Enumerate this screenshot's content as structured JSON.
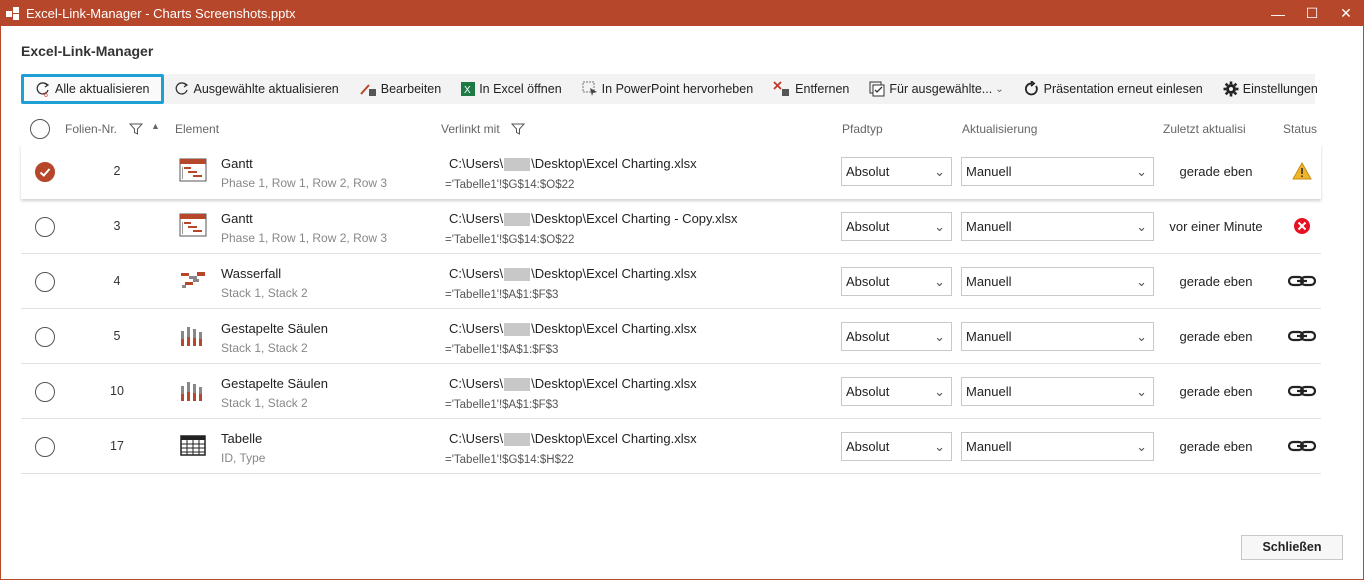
{
  "window": {
    "title": "Excel-Link-Manager - Charts Screenshots.pptx",
    "minimize": "—",
    "maximize": "☐",
    "close": "✕"
  },
  "heading": "Excel-Link-Manager",
  "toolbar": {
    "update_all": "Alle aktualisieren",
    "update_selected": "Ausgewählte aktualisieren",
    "edit": "Bearbeiten",
    "open_excel": "In Excel öffnen",
    "highlight_ppt": "In PowerPoint hervorheben",
    "remove": "Entfernen",
    "for_selected": "Für ausgewählte...",
    "reload": "Präsentation erneut einlesen",
    "settings": "Einstellungen",
    "update_badge": "6"
  },
  "columns": {
    "slide": "Folien-Nr.",
    "element": "Element",
    "linked": "Verlinkt mit",
    "pathtype": "Pfadtyp",
    "update": "Aktualisierung",
    "last": "Zuletzt aktualisi",
    "status": "Status"
  },
  "rows": [
    {
      "selected": true,
      "slide": "2",
      "icon": "gantt-icon",
      "name": "Gantt",
      "sub": "Phase 1, Row 1, Row 2, Row 3",
      "path_pre": "C:\\Users\\",
      "path_post": "\\Desktop\\Excel Charting.xlsx",
      "range": "='Tabelle1'!$G$14:$O$22",
      "pathtype": "Absolut",
      "update": "Manuell",
      "last": "gerade eben",
      "status": "warning-icon"
    },
    {
      "selected": false,
      "slide": "3",
      "icon": "gantt-icon",
      "name": "Gantt",
      "sub": "Phase 1, Row 1, Row 2, Row 3",
      "path_pre": "C:\\Users\\",
      "path_post": "\\Desktop\\Excel Charting - Copy.xlsx",
      "range": "='Tabelle1'!$G$14:$O$22",
      "pathtype": "Absolut",
      "update": "Manuell",
      "last": "vor einer Minute",
      "status": "error-icon"
    },
    {
      "selected": false,
      "slide": "4",
      "icon": "waterfall-icon",
      "name": "Wasserfall",
      "sub": "Stack 1, Stack 2",
      "path_pre": "C:\\Users\\",
      "path_post": "\\Desktop\\Excel Charting.xlsx",
      "range": "='Tabelle1'!$A$1:$F$3",
      "pathtype": "Absolut",
      "update": "Manuell",
      "last": "gerade eben",
      "status": "link-icon"
    },
    {
      "selected": false,
      "slide": "5",
      "icon": "stacked-column-icon",
      "name": "Gestapelte Säulen",
      "sub": "Stack 1, Stack 2",
      "path_pre": "C:\\Users\\",
      "path_post": "\\Desktop\\Excel Charting.xlsx",
      "range": "='Tabelle1'!$A$1:$F$3",
      "pathtype": "Absolut",
      "update": "Manuell",
      "last": "gerade eben",
      "status": "link-icon"
    },
    {
      "selected": false,
      "slide": "10",
      "icon": "stacked-column-icon",
      "name": "Gestapelte Säulen",
      "sub": "Stack 1, Stack 2",
      "path_pre": "C:\\Users\\",
      "path_post": "\\Desktop\\Excel Charting.xlsx",
      "range": "='Tabelle1'!$A$1:$F$3",
      "pathtype": "Absolut",
      "update": "Manuell",
      "last": "gerade eben",
      "status": "link-icon"
    },
    {
      "selected": false,
      "slide": "17",
      "icon": "table-icon",
      "name": "Tabelle",
      "sub": "ID, Type",
      "path_pre": "C:\\Users\\",
      "path_post": "\\Desktop\\Excel Charting.xlsx",
      "range": "='Tabelle1'!$G$14:$H$22",
      "pathtype": "Absolut",
      "update": "Manuell",
      "last": "gerade eben",
      "status": "link-icon"
    }
  ],
  "close_button": "Schließen"
}
